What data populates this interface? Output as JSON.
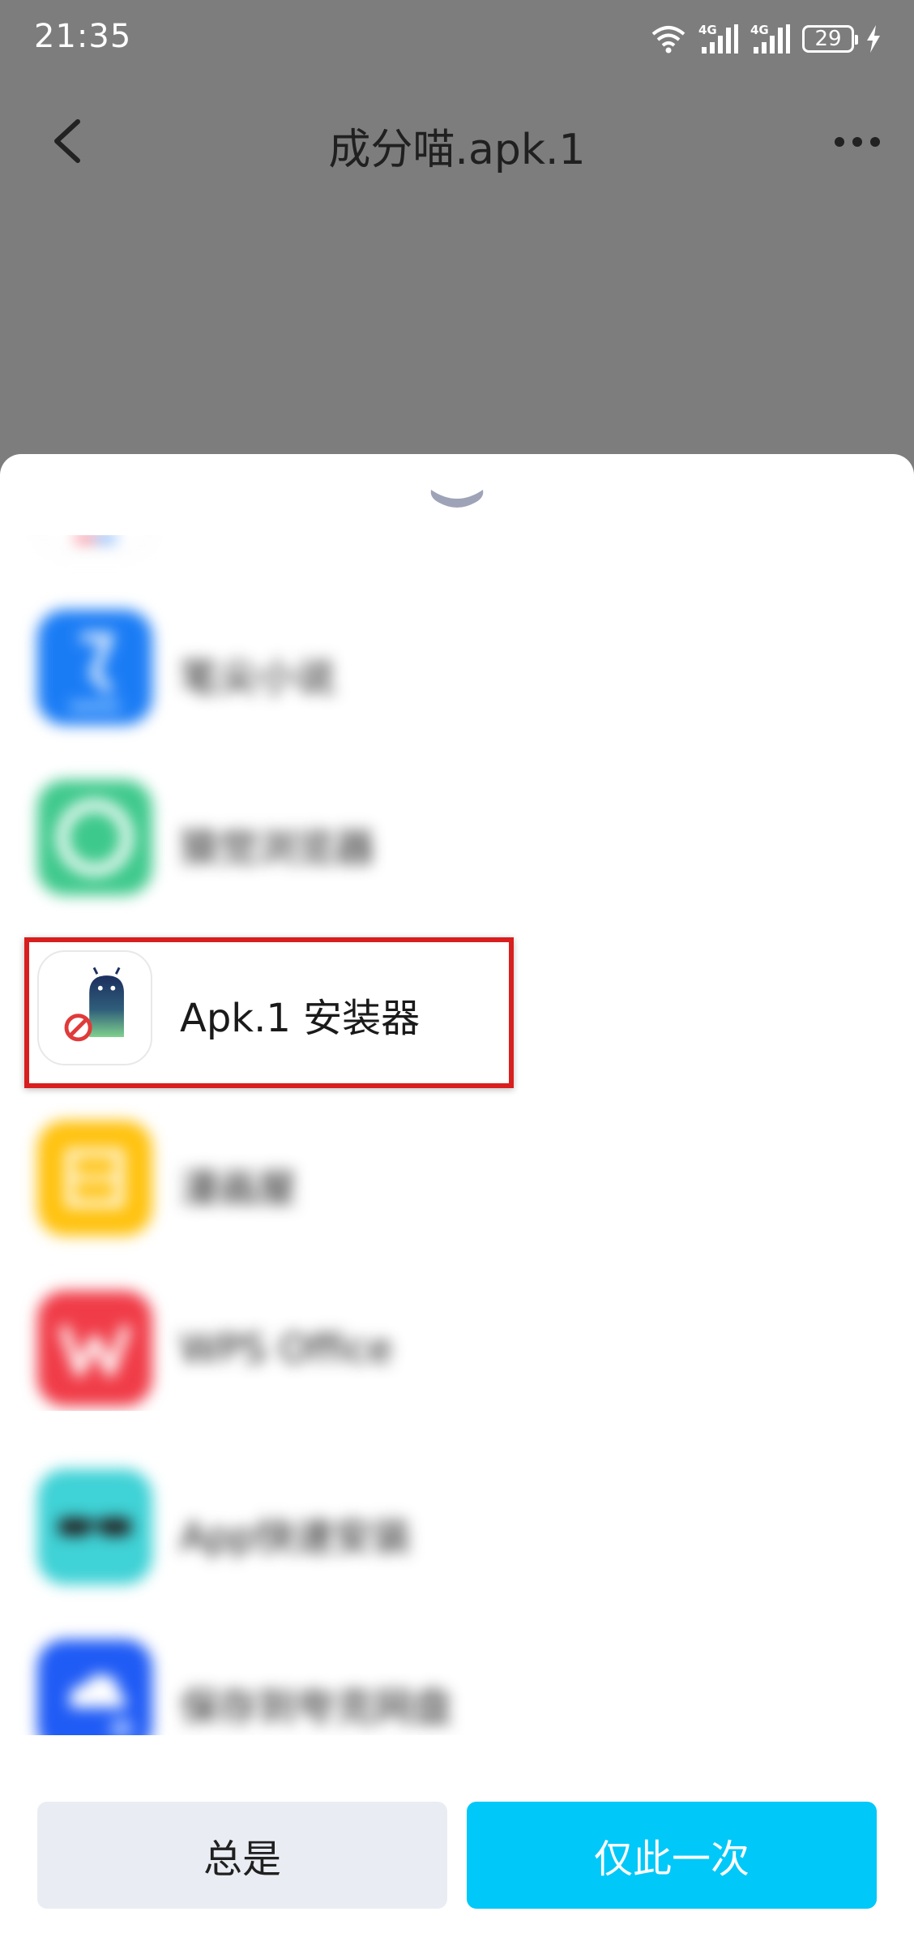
{
  "status_bar": {
    "time": "21:35",
    "battery": "29",
    "signal_1_label": "4G",
    "signal_2_label": "4G"
  },
  "header": {
    "title": "成分喵.apk.1"
  },
  "chooser": {
    "apps": [
      {
        "label": "",
        "icon": "app-icon-partial",
        "blurred": true
      },
      {
        "label": "笔尖小说",
        "icon": "novel-app-icon",
        "blurred": true
      },
      {
        "label": "猿觉浏览器",
        "icon": "browser-app-icon",
        "blurred": true
      },
      {
        "label": "Apk.1 安装器",
        "icon": "android-installer-icon",
        "blurred": false
      },
      {
        "label": "漫画屋",
        "icon": "comic-app-icon",
        "blurred": true
      },
      {
        "label": "WPS Office",
        "icon": "wps-office-icon",
        "blurred": true
      },
      {
        "label": "App快速安装",
        "icon": "fast-install-app-icon",
        "blurred": true
      },
      {
        "label": "保存到夸克网盘",
        "icon": "cloud-drive-app-icon",
        "blurred": true
      }
    ],
    "buttons": {
      "always": "总是",
      "once": "仅此一次"
    }
  },
  "colors": {
    "accent": "#00c8f8",
    "highlight": "#d81e1e",
    "secondary_button": "#e9edf3"
  }
}
